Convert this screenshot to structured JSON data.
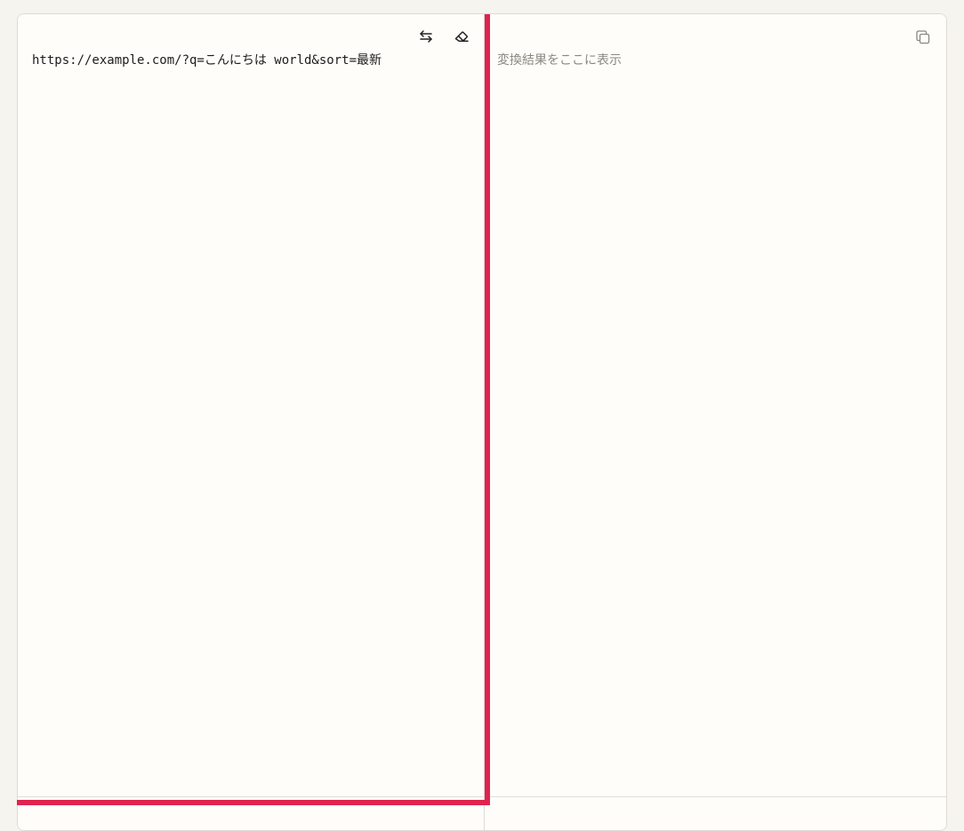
{
  "input": {
    "value": "https://example.com/?q=こんにちは world&sort=最新"
  },
  "output": {
    "placeholder": "変換結果をここに表示"
  },
  "toolbar": {
    "swap_icon": "swap-arrows-icon",
    "clear_icon": "eraser-icon",
    "copy_icon": "copy-icon"
  },
  "colors": {
    "active_border": "#e0234e",
    "panel_bg": "#fefdf9",
    "page_bg": "#f6f4ef",
    "border": "#dedbd3",
    "placeholder_text": "#8a8880"
  }
}
